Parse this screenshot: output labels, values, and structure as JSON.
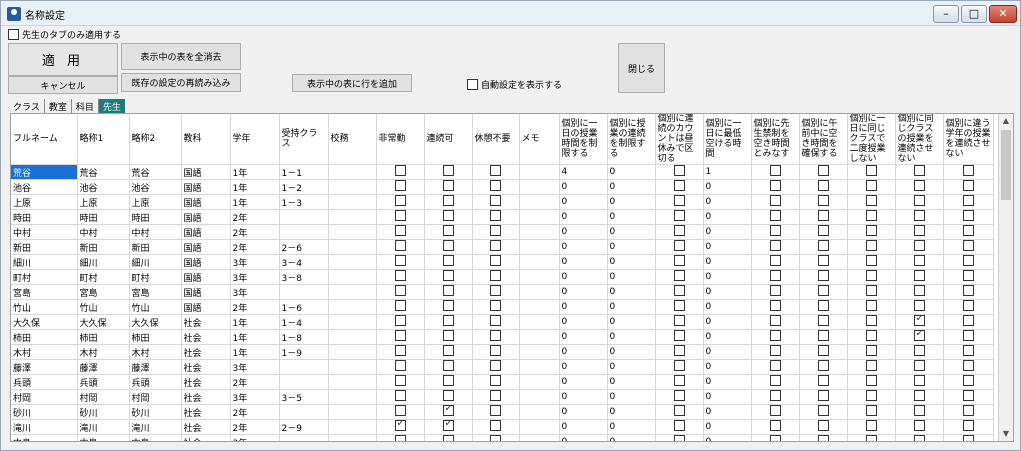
{
  "window": {
    "title": "名称設定",
    "icon": "app-icon"
  },
  "controls": {
    "teacher_tab_only": "先生のタブのみ適用する",
    "apply": "適 用",
    "cancel": "キャンセル",
    "clear_all": "表示中の表を全消去",
    "reload": "既存の設定の再読み込み",
    "add_row": "表示中の表に行を追加",
    "auto_show": "自動設定を表示する",
    "close": "閉じる"
  },
  "tabs": [
    "クラス",
    "教室",
    "科目",
    "先生"
  ],
  "active_tab": 3,
  "columns": [
    "フルネーム",
    "略称1",
    "略称2",
    "教科",
    "学年",
    "受持クラス",
    "校務",
    "非常勤",
    "連続可",
    "休憩不要",
    "メモ",
    "個別に一日の授業時間を制限する",
    "個別に授業の連続を制限する",
    "個別に連続のカウントは昼休みで区切る",
    "個別に一日に最低空ける時間",
    "個別に先生禁制を空き時間とみなす",
    "個別に午前中に空き時間を確保する",
    "個別に一日に同じクラスで二度授業しない",
    "個別に同じクラスの授業を連続させない",
    "個別に違う学年の授業を連続させない"
  ],
  "rows": [
    {
      "full": "荒谷",
      "a1": "荒谷",
      "a2": "荒谷",
      "subj": "国語",
      "grade": "1年",
      "cls": "1－1",
      "h": false,
      "r": false,
      "k": false,
      "lim": "4",
      "cont": "0",
      "noon": false,
      "min": "1",
      "free": false,
      "am": false,
      "twice": false,
      "samecls": false,
      "diffgr": false
    },
    {
      "full": "池谷",
      "a1": "池谷",
      "a2": "池谷",
      "subj": "国語",
      "grade": "1年",
      "cls": "1－2",
      "h": false,
      "r": false,
      "k": false,
      "lim": "0",
      "cont": "0",
      "noon": false,
      "min": "0",
      "free": false,
      "am": false,
      "twice": false,
      "samecls": false,
      "diffgr": false
    },
    {
      "full": "上原",
      "a1": "上原",
      "a2": "上原",
      "subj": "国語",
      "grade": "1年",
      "cls": "1－3",
      "h": false,
      "r": false,
      "k": false,
      "lim": "0",
      "cont": "0",
      "noon": false,
      "min": "0",
      "free": false,
      "am": false,
      "twice": false,
      "samecls": false,
      "diffgr": false
    },
    {
      "full": "時田",
      "a1": "時田",
      "a2": "時田",
      "subj": "国語",
      "grade": "2年",
      "cls": "",
      "h": false,
      "r": false,
      "k": false,
      "lim": "0",
      "cont": "0",
      "noon": false,
      "min": "0",
      "free": false,
      "am": false,
      "twice": false,
      "samecls": false,
      "diffgr": false
    },
    {
      "full": "中村",
      "a1": "中村",
      "a2": "中村",
      "subj": "国語",
      "grade": "2年",
      "cls": "",
      "h": false,
      "r": false,
      "k": false,
      "lim": "0",
      "cont": "0",
      "noon": false,
      "min": "0",
      "free": false,
      "am": false,
      "twice": false,
      "samecls": false,
      "diffgr": false
    },
    {
      "full": "新田",
      "a1": "新田",
      "a2": "新田",
      "subj": "国語",
      "grade": "2年",
      "cls": "2－6",
      "h": false,
      "r": false,
      "k": false,
      "lim": "0",
      "cont": "0",
      "noon": false,
      "min": "0",
      "free": false,
      "am": false,
      "twice": false,
      "samecls": false,
      "diffgr": false
    },
    {
      "full": "細川",
      "a1": "細川",
      "a2": "細川",
      "subj": "国語",
      "grade": "3年",
      "cls": "3－4",
      "h": false,
      "r": false,
      "k": false,
      "lim": "0",
      "cont": "0",
      "noon": false,
      "min": "0",
      "free": false,
      "am": false,
      "twice": false,
      "samecls": false,
      "diffgr": false
    },
    {
      "full": "町村",
      "a1": "町村",
      "a2": "町村",
      "subj": "国語",
      "grade": "3年",
      "cls": "3－8",
      "h": false,
      "r": false,
      "k": false,
      "lim": "0",
      "cont": "0",
      "noon": false,
      "min": "0",
      "free": false,
      "am": false,
      "twice": false,
      "samecls": false,
      "diffgr": false
    },
    {
      "full": "宮島",
      "a1": "宮島",
      "a2": "宮島",
      "subj": "国語",
      "grade": "3年",
      "cls": "",
      "h": false,
      "r": false,
      "k": false,
      "lim": "0",
      "cont": "0",
      "noon": false,
      "min": "0",
      "free": false,
      "am": false,
      "twice": false,
      "samecls": false,
      "diffgr": false
    },
    {
      "full": "竹山",
      "a1": "竹山",
      "a2": "竹山",
      "subj": "国語",
      "grade": "2年",
      "cls": "1－6",
      "h": false,
      "r": false,
      "k": false,
      "lim": "0",
      "cont": "0",
      "noon": false,
      "min": "0",
      "free": false,
      "am": false,
      "twice": false,
      "samecls": false,
      "diffgr": false
    },
    {
      "full": "大久保",
      "a1": "大久保",
      "a2": "大久保",
      "subj": "社会",
      "grade": "1年",
      "cls": "1－4",
      "h": false,
      "r": false,
      "k": false,
      "lim": "0",
      "cont": "0",
      "noon": false,
      "min": "0",
      "free": false,
      "am": false,
      "twice": false,
      "samecls": true,
      "diffgr": false
    },
    {
      "full": "柿田",
      "a1": "柿田",
      "a2": "柿田",
      "subj": "社会",
      "grade": "1年",
      "cls": "1－8",
      "h": false,
      "r": false,
      "k": false,
      "lim": "0",
      "cont": "0",
      "noon": false,
      "min": "0",
      "free": false,
      "am": false,
      "twice": false,
      "samecls": true,
      "diffgr": false
    },
    {
      "full": "木村",
      "a1": "木村",
      "a2": "木村",
      "subj": "社会",
      "grade": "1年",
      "cls": "1－9",
      "h": false,
      "r": false,
      "k": false,
      "lim": "0",
      "cont": "0",
      "noon": false,
      "min": "0",
      "free": false,
      "am": false,
      "twice": false,
      "samecls": false,
      "diffgr": false
    },
    {
      "full": "藤澤",
      "a1": "藤澤",
      "a2": "藤澤",
      "subj": "社会",
      "grade": "3年",
      "cls": "",
      "h": false,
      "r": false,
      "k": false,
      "lim": "0",
      "cont": "0",
      "noon": false,
      "min": "0",
      "free": false,
      "am": false,
      "twice": false,
      "samecls": false,
      "diffgr": false
    },
    {
      "full": "兵頭",
      "a1": "兵頭",
      "a2": "兵頭",
      "subj": "社会",
      "grade": "2年",
      "cls": "",
      "h": false,
      "r": false,
      "k": false,
      "lim": "0",
      "cont": "0",
      "noon": false,
      "min": "0",
      "free": false,
      "am": false,
      "twice": false,
      "samecls": false,
      "diffgr": false
    },
    {
      "full": "村岡",
      "a1": "村岡",
      "a2": "村岡",
      "subj": "社会",
      "grade": "3年",
      "cls": "3－5",
      "h": false,
      "r": false,
      "k": false,
      "lim": "0",
      "cont": "0",
      "noon": false,
      "min": "0",
      "free": false,
      "am": false,
      "twice": false,
      "samecls": false,
      "diffgr": false
    },
    {
      "full": "砂川",
      "a1": "砂川",
      "a2": "砂川",
      "subj": "社会",
      "grade": "2年",
      "cls": "",
      "h": false,
      "r": true,
      "k": false,
      "lim": "0",
      "cont": "0",
      "noon": false,
      "min": "0",
      "free": false,
      "am": false,
      "twice": false,
      "samecls": false,
      "diffgr": false
    },
    {
      "full": "滝川",
      "a1": "滝川",
      "a2": "滝川",
      "subj": "社会",
      "grade": "2年",
      "cls": "2－9",
      "h": true,
      "r": true,
      "k": false,
      "lim": "0",
      "cont": "0",
      "noon": false,
      "min": "0",
      "free": false,
      "am": false,
      "twice": false,
      "samecls": false,
      "diffgr": false
    },
    {
      "full": "中島",
      "a1": "中島",
      "a2": "中島",
      "subj": "社会",
      "grade": "3年",
      "cls": "",
      "h": false,
      "r": false,
      "k": false,
      "lim": "0",
      "cont": "0",
      "noon": false,
      "min": "0",
      "free": false,
      "am": false,
      "twice": false,
      "samecls": false,
      "diffgr": false
    }
  ]
}
